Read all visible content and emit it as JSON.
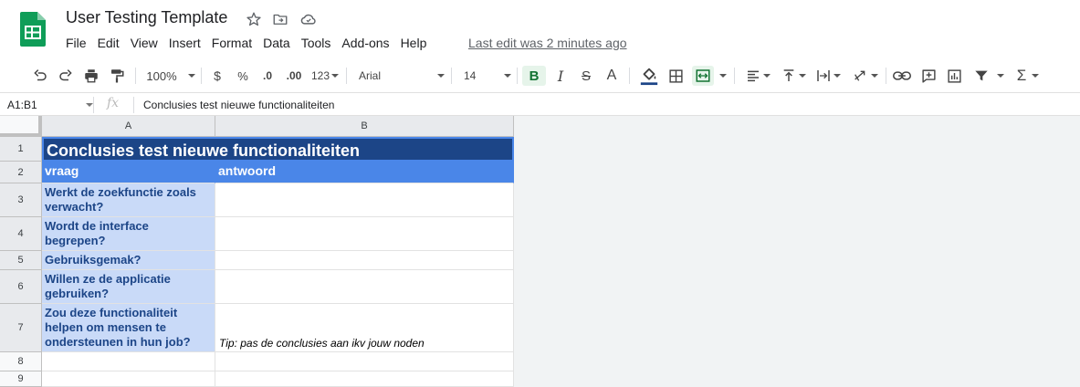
{
  "app": {
    "title": "User Testing Template",
    "last_edit": "Last edit was 2 minutes ago",
    "brand_color": "#0f9d58"
  },
  "menu": [
    "File",
    "Edit",
    "View",
    "Insert",
    "Format",
    "Data",
    "Tools",
    "Add-ons",
    "Help"
  ],
  "toolbar": {
    "zoom": "100%",
    "currency": "$",
    "percent": "%",
    "decrease_decimals": ".0",
    "increase_decimals": ".00",
    "more_formats": "123",
    "font": "Arial",
    "font_size": "14",
    "bold": "B",
    "italic": "I",
    "strikethrough": "S",
    "text_color": "A",
    "functions": "Σ"
  },
  "formula_bar": {
    "name_box": "A1:B1",
    "fx": "fx",
    "content": "Conclusies test nieuwe functionaliteiten"
  },
  "grid": {
    "columns": [
      "A",
      "B"
    ],
    "rows": [
      "1",
      "2",
      "3",
      "4",
      "5",
      "6",
      "7",
      "8",
      "9"
    ],
    "title": "Conclusies test nieuwe functionaliteiten",
    "header": {
      "a": "vraag",
      "b": "antwoord"
    },
    "questions": [
      "Werkt de zoekfunctie zoals verwacht?",
      "Wordt de interface begrepen?",
      "Gebruiksgemak?",
      "Willen ze de applicatie gebruiken?",
      "Zou deze functionaliteit helpen om mensen te ondersteunen in hun job?"
    ],
    "tip": "Tip: pas de conclusies aan ikv jouw noden",
    "colors": {
      "title_bg": "#1c4587",
      "header_bg": "#4a86e8",
      "question_bg": "#c9daf8",
      "question_text": "#1c4587"
    }
  }
}
